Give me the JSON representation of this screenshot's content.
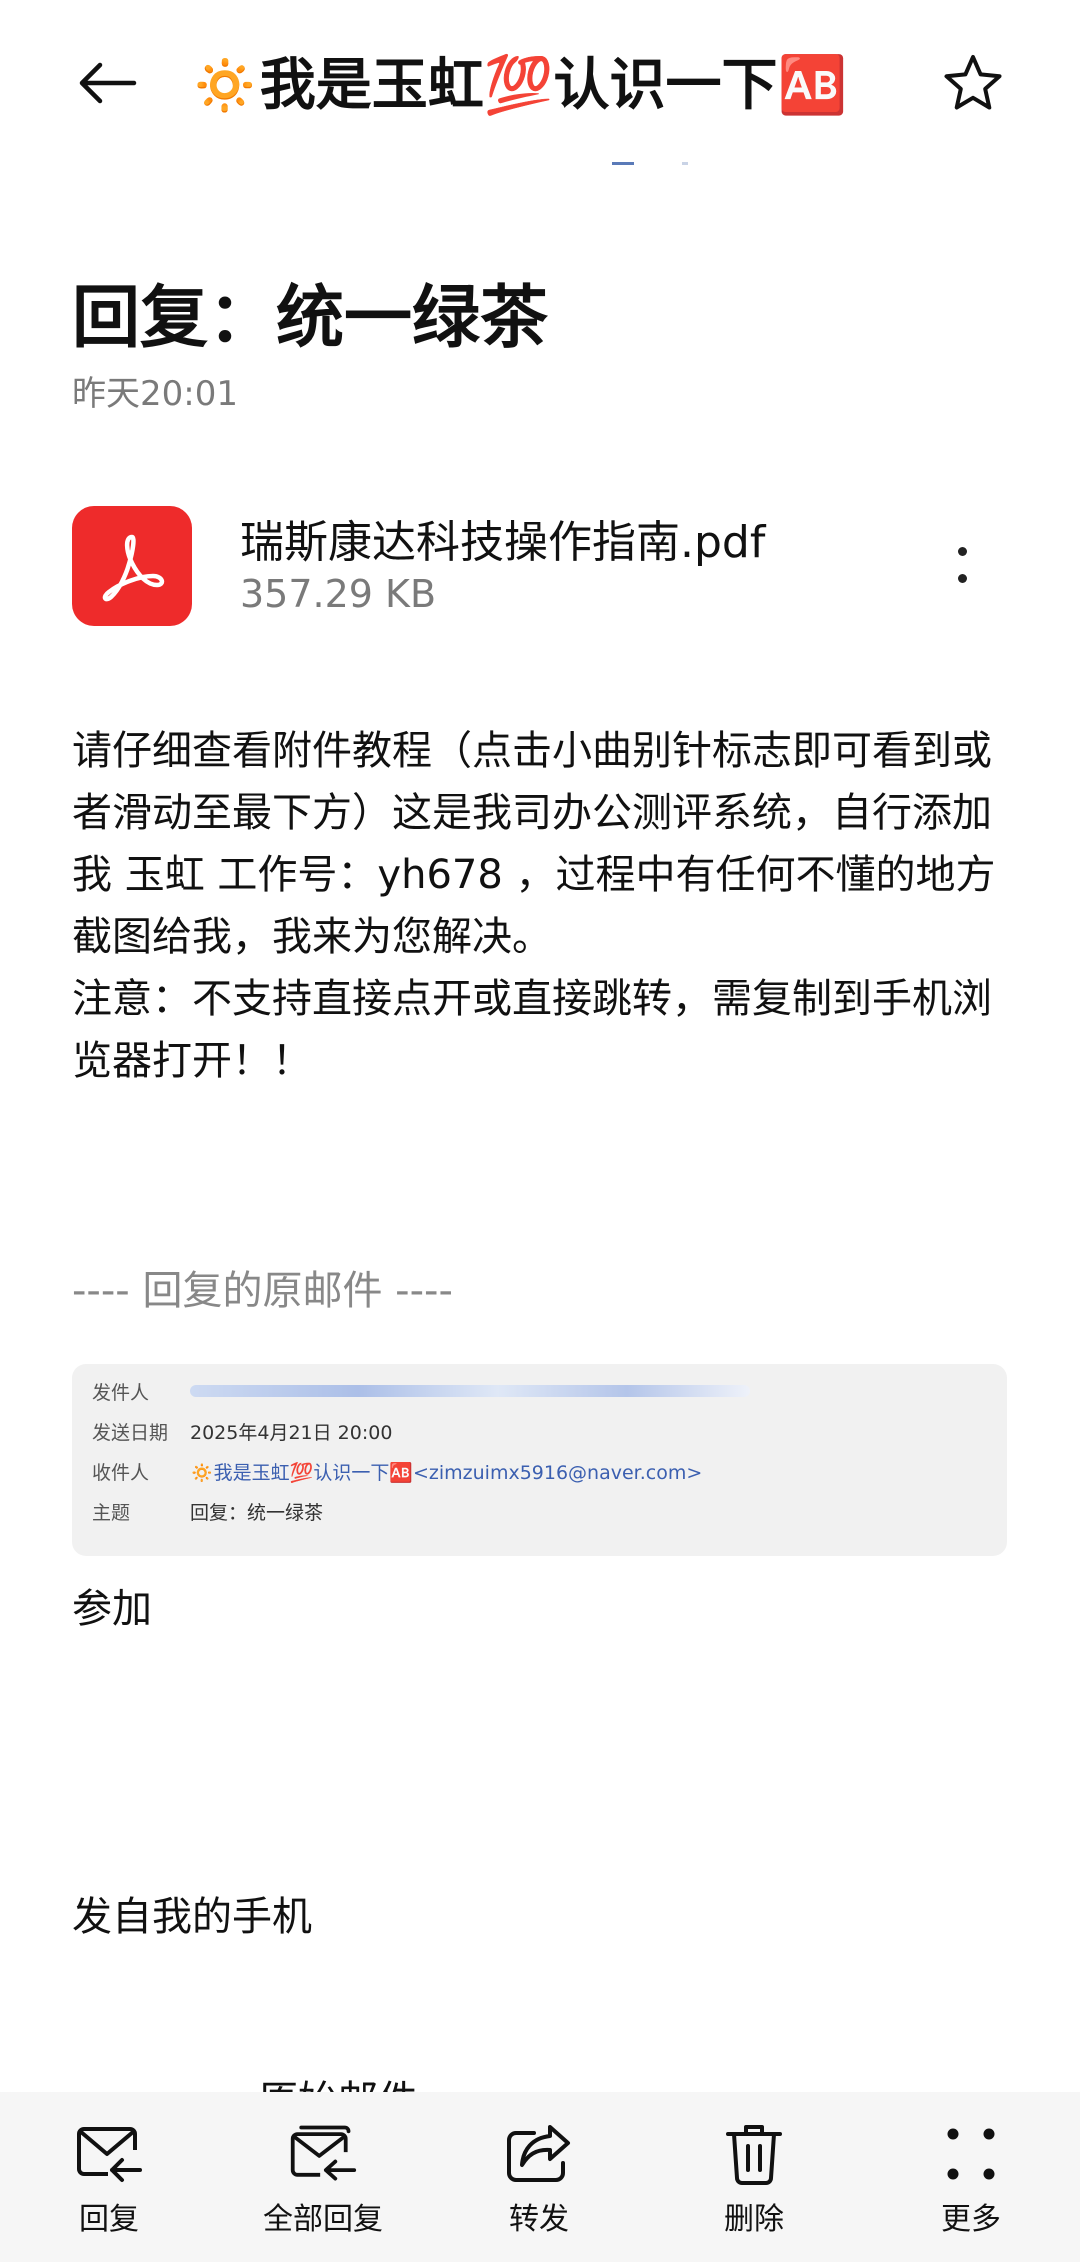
{
  "header": {
    "title": "🔅我是玉虹💯认识一下🆎"
  },
  "message": {
    "subject": "回复：统一绿茶",
    "date": "昨天20:01",
    "attachment": {
      "name": "瑞斯康达科技操作指南.pdf",
      "size": "357.29 KB"
    },
    "body": [
      "请仔细查看附件教程（点击小曲别针标志即可看到或者滑动至最下方）这是我司办公测评系统，自行添加我 玉虹 工作号：yh678 ，过程中有任何不懂的地方截图给我，我来为您解决。",
      "注意：不支持直接点开或直接跳转，需复制到手机浏览器打开！！"
    ],
    "quoted_header": "---- 回复的原邮件 ----",
    "original": {
      "sender_label": "发件人",
      "date_label": "发送日期",
      "date_value": "2025年4月21日 20:00",
      "recipient_label": "收件人",
      "recipient_value": "🔅我是玉虹💯认识一下🆎<zimzuimx5916@naver.com>",
      "subject_label": "主题",
      "subject_value": "回复：统一绿茶"
    },
    "canjia": "参加",
    "signature": "发自我的手机",
    "partial_text": "原始邮件"
  },
  "toolbar": {
    "reply": "回复",
    "reply_all": "全部回复",
    "forward": "转发",
    "delete": "删除",
    "more": "更多"
  },
  "colors": {
    "pdf_red": "#ee2b2b",
    "muted_text": "#7a7a7a",
    "link_blue": "#3b5fb0"
  }
}
